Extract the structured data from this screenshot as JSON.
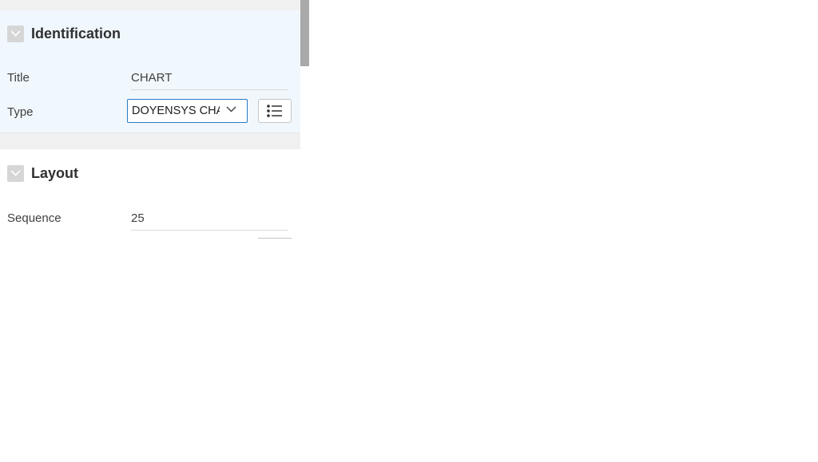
{
  "identification": {
    "title": "Identification",
    "fields": {
      "title": {
        "label": "Title",
        "value": "CHART"
      },
      "type": {
        "label": "Type",
        "selected": "DOYENSYS CHART"
      }
    }
  },
  "layout": {
    "title": "Layout",
    "fields": {
      "sequence": {
        "label": "Sequence",
        "value": "25"
      }
    }
  },
  "icons": {
    "section_toggle": "chevron-down-icon",
    "select_arrow": "chevron-down-icon",
    "list_button": "list-icon"
  },
  "colors": {
    "section_background": "#f0f7fd",
    "focus_border": "#2a7bc4",
    "strip_gray": "#f0f0f0",
    "scroll_thumb": "#a9a9a9"
  }
}
